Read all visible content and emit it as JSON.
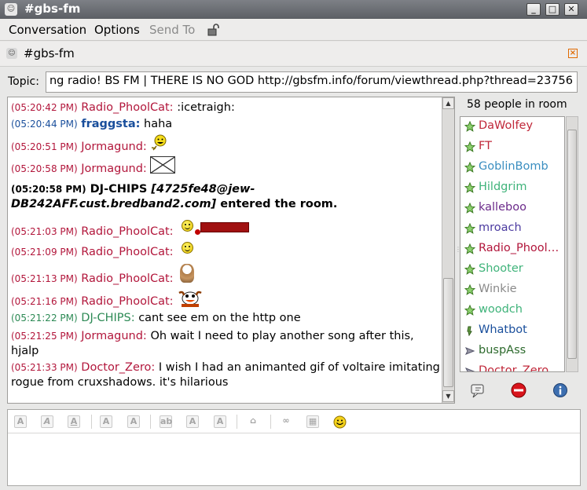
{
  "window": {
    "title": "#gbs-fm"
  },
  "menu": {
    "conversation": "Conversation",
    "options": "Options",
    "send_to": "Send To"
  },
  "tab": {
    "label": "#gbs-fm"
  },
  "topic": {
    "label": "Topic:",
    "value": "ng radio! BS FM | THERE IS NO GOD http://gbsfm.info/forum/viewthread.php?thread=23756"
  },
  "messages": [
    {
      "time": "(05:20:42 PM)",
      "nick": "Radio_PhoolCat:",
      "text": ":icetraigh:"
    },
    {
      "time": "(05:20:44 PM)",
      "nick": "fraggsta:",
      "text": "haha"
    },
    {
      "time": "(05:20:51 PM)",
      "nick": "Jormagund:",
      "text": ""
    },
    {
      "time": "(05:20:58 PM)",
      "nick": "Jormagund:",
      "text": ""
    },
    {
      "time": "(05:20:58 PM)",
      "nick": "DJ-CHIPS",
      "host": "[4725fe48@jew-DB242AFF.cust.bredband2.com]",
      "text": "entered the room."
    },
    {
      "time": "(05:21:03 PM)",
      "nick": "Radio_PhoolCat:",
      "text": ""
    },
    {
      "time": "(05:21:09 PM)",
      "nick": "Radio_PhoolCat:",
      "text": ""
    },
    {
      "time": "(05:21:13 PM)",
      "nick": "Radio_PhoolCat:",
      "text": ""
    },
    {
      "time": "(05:21:16 PM)",
      "nick": "Radio_PhoolCat:",
      "text": ""
    },
    {
      "time": "(05:21:22 PM)",
      "nick": "DJ-CHIPS:",
      "text": "cant see em on the http one"
    },
    {
      "time": "(05:21:25 PM)",
      "nick": "Jormagund:",
      "text": "Oh wait I need to play another song after this, hjalp"
    },
    {
      "time": "(05:21:33 PM)",
      "nick": "Doctor_Zero:",
      "text": "I wish I had an animanted gif of voltaire imitating rogue from cruxshadows. it's hilarious"
    }
  ],
  "people": {
    "count_label": "58 people in room",
    "list": [
      {
        "name": "DaWolfey",
        "color": "#c0283a",
        "icon": "green-star-icon"
      },
      {
        "name": "FT",
        "color": "#c0283a",
        "icon": "green-star-icon"
      },
      {
        "name": "GoblinBomb",
        "color": "#3a8ec0",
        "icon": "green-star-icon"
      },
      {
        "name": "Hildgrim",
        "color": "#3fb37a",
        "icon": "green-star-icon"
      },
      {
        "name": "kalleboo",
        "color": "#6b2a8a",
        "icon": "green-star-icon"
      },
      {
        "name": "mroach",
        "color": "#4b3aa0",
        "icon": "green-star-icon"
      },
      {
        "name": "Radio_PhoolCat",
        "color": "#b2163b",
        "icon": "green-star-icon"
      },
      {
        "name": "Shooter",
        "color": "#3fb37a",
        "icon": "green-star-icon"
      },
      {
        "name": "Winkie",
        "color": "#8a8a8a",
        "icon": "green-star-icon"
      },
      {
        "name": "woodch",
        "color": "#3fb37a",
        "icon": "green-star-icon"
      },
      {
        "name": "Whatbot",
        "color": "#1a4f9c",
        "icon": "bot-icon"
      },
      {
        "name": "buspAss",
        "color": "#2d6a2d",
        "icon": "voice-arrow-icon"
      },
      {
        "name": "Doctor_Zero",
        "color": "#c0283a",
        "icon": "voice-arrow-icon"
      }
    ]
  }
}
